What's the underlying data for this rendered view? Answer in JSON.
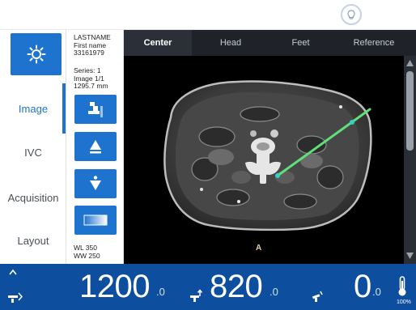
{
  "patient": {
    "last_name": "LASTNAME",
    "first_name": "First name",
    "id": "33161979"
  },
  "series": {
    "series_label": "Series: 1",
    "image_label": "Image 1/1",
    "position": "1295.7 mm"
  },
  "window": {
    "wl": "WL 350",
    "ww": "WW 250"
  },
  "nav": {
    "items": [
      {
        "label": "Image",
        "active": true
      },
      {
        "label": "IVC",
        "active": false
      },
      {
        "label": "Acquisition",
        "active": false
      },
      {
        "label": "Layout",
        "active": false
      }
    ]
  },
  "viewer": {
    "tabs": [
      {
        "label": "Center",
        "active": true
      },
      {
        "label": "Head",
        "active": false
      },
      {
        "label": "Feet",
        "active": false
      },
      {
        "label": "Reference",
        "active": false
      }
    ],
    "orientation_marker": "A"
  },
  "bottom": {
    "value1_int": "1200",
    "value1_dec": ".0",
    "value2_int": "820",
    "value2_dec": ".0",
    "value3_int": "0",
    "value3_dec": ".0",
    "thermometer_percent": "100%"
  },
  "colors": {
    "accent": "#1e73cf",
    "bottom_bar": "#0d4f9e",
    "needle": "#5fe07a"
  },
  "icons": [
    "lights-icon",
    "bulb-icon",
    "table-position-icon",
    "move-up-icon",
    "move-down-icon",
    "gradient-icon",
    "caret-up-icon",
    "table-horizontal-icon",
    "table-vertical-icon",
    "table-tilt-icon",
    "thermometer-icon"
  ]
}
